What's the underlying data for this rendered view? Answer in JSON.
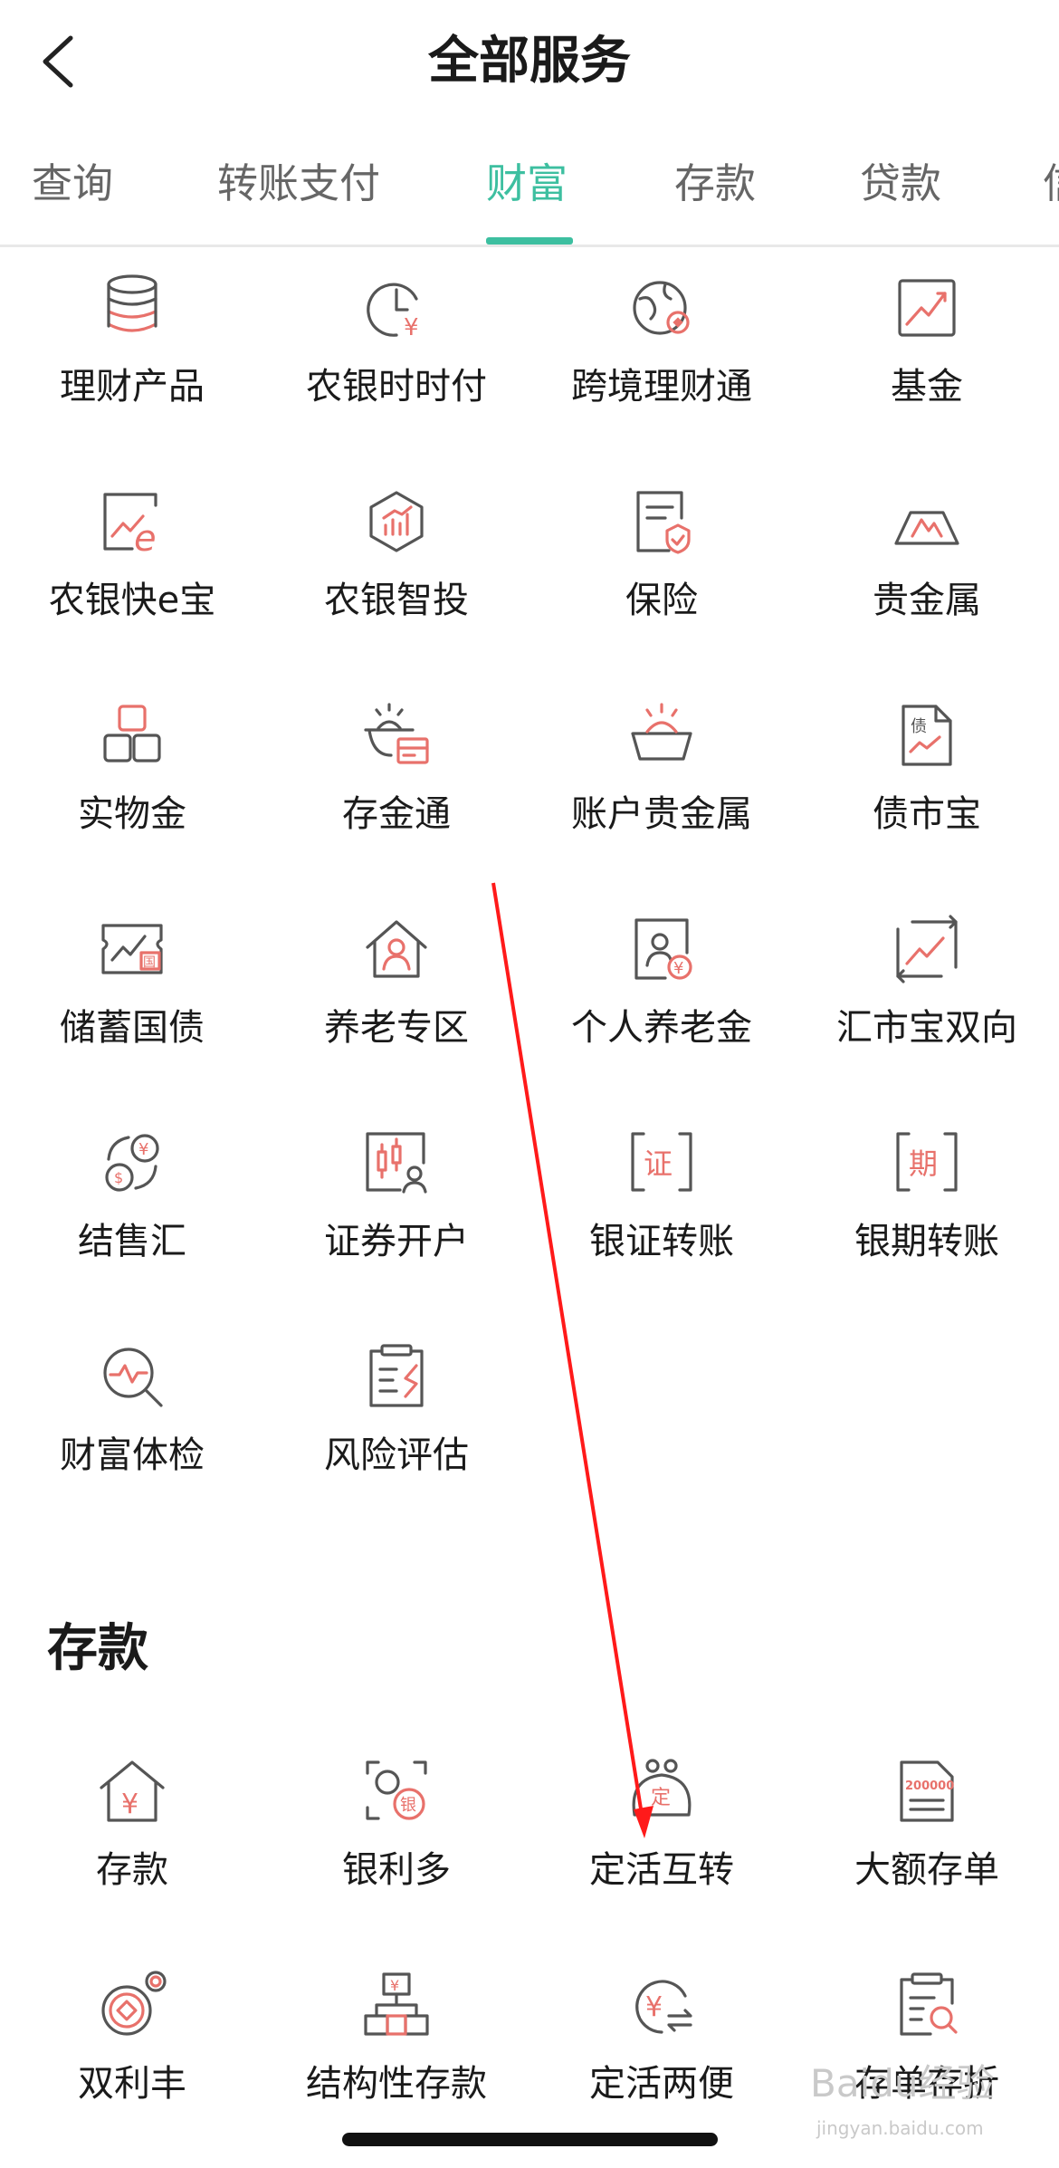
{
  "header": {
    "title": "全部服务"
  },
  "tabs": [
    {
      "label": "查询"
    },
    {
      "label": "转账支付"
    },
    {
      "label": "财富"
    },
    {
      "label": "存款"
    },
    {
      "label": "贷款"
    },
    {
      "label": "信"
    }
  ],
  "active_tab": "财富",
  "wealth_items": [
    {
      "label": "理财产品",
      "icon": "coin-stack-icon"
    },
    {
      "label": "农银时时付",
      "icon": "clock-yuan-icon"
    },
    {
      "label": "跨境理财通",
      "icon": "globe-icon"
    },
    {
      "label": "基金",
      "icon": "trend-chart-icon"
    },
    {
      "label": "农银快e宝",
      "icon": "chart-e-icon"
    },
    {
      "label": "农银智投",
      "icon": "hexagon-chart-icon"
    },
    {
      "label": "保险",
      "icon": "document-shield-icon"
    },
    {
      "label": "贵金属",
      "icon": "gold-bar-icon"
    },
    {
      "label": "实物金",
      "icon": "gold-blocks-icon"
    },
    {
      "label": "存金通",
      "icon": "gold-bowl-card-icon"
    },
    {
      "label": "账户贵金属",
      "icon": "gold-bowl-icon"
    },
    {
      "label": "债市宝",
      "icon": "bond-document-icon"
    },
    {
      "label": "储蓄国债",
      "icon": "national-bond-ticket-icon"
    },
    {
      "label": "养老专区",
      "icon": "house-person-icon"
    },
    {
      "label": "个人养老金",
      "icon": "pension-card-icon"
    },
    {
      "label": "汇市宝双向",
      "icon": "forex-chart-icon"
    },
    {
      "label": "结售汇",
      "icon": "currency-exchange-icon"
    },
    {
      "label": "证券开户",
      "icon": "candlestick-person-icon"
    },
    {
      "label": "银证转账",
      "icon": "securities-transfer-icon"
    },
    {
      "label": "银期转账",
      "icon": "futures-transfer-icon"
    },
    {
      "label": "财富体检",
      "icon": "magnifier-pulse-icon"
    },
    {
      "label": "风险评估",
      "icon": "clipboard-risk-icon"
    }
  ],
  "deposit_section": {
    "title": "存款",
    "items": [
      {
        "label": "存款",
        "icon": "house-yuan-icon"
      },
      {
        "label": "银利多",
        "icon": "silver-coin-icon"
      },
      {
        "label": "定活互转",
        "icon": "purse-fixed-icon"
      },
      {
        "label": "大额存单",
        "icon": "certificate-document-icon"
      },
      {
        "label": "双利丰",
        "icon": "double-coin-icon"
      },
      {
        "label": "结构性存款",
        "icon": "structure-tree-icon"
      },
      {
        "label": "定活两便",
        "icon": "yuan-exchange-icon"
      },
      {
        "label": "存单存折",
        "icon": "clipboard-search-icon"
      }
    ]
  },
  "watermark": {
    "text": "Baidu经验",
    "sub": "jingyan.baidu.com"
  },
  "colors": {
    "accent": "#3dbfa0",
    "icon_red": "#e8716b",
    "icon_gray": "#555555",
    "annotation_arrow": "#ff1a1a"
  }
}
